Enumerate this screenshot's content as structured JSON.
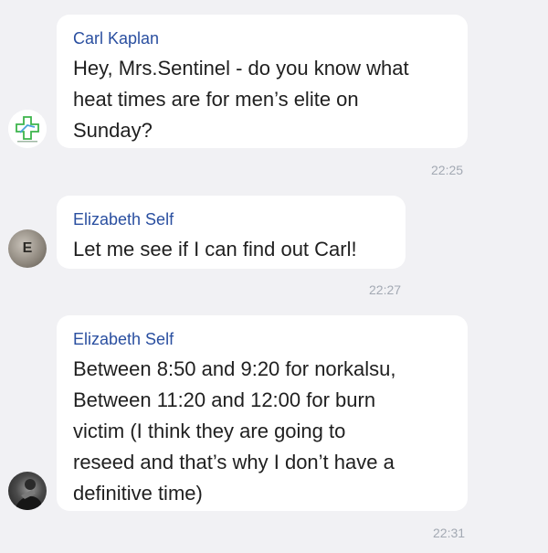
{
  "messages": [
    {
      "sender": "Carl Kaplan",
      "lines": [
        "Hey, Mrs.Sentinel - do you know what",
        "heat times are for men’s elite on",
        "Sunday?"
      ],
      "time": "22:25",
      "avatar_icon": "medical-cross-logo-icon"
    },
    {
      "sender": "Elizabeth Self",
      "lines": [
        "Let me see if I can find out Carl!"
      ],
      "time": "22:27",
      "avatar_letter": "E"
    },
    {
      "sender": "Elizabeth Self",
      "lines": [
        "Between 8:50 and 9:20 for norkalsu,",
        "Between 11:20 and 12:00 for burn",
        "victim (I think they are going to",
        "reseed and that’s why I don’t have a",
        "definitive time)"
      ],
      "time": "22:31",
      "avatar_icon": "user-photo-icon"
    }
  ],
  "colors": {
    "background": "#f1f1f4",
    "bubble": "#ffffff",
    "sender": "#2a4fa0",
    "text": "#1f1f1f",
    "timestamp": "#a3a9b3",
    "logo_green": "#3cb44b",
    "logo_blue": "#4aa3d9"
  }
}
